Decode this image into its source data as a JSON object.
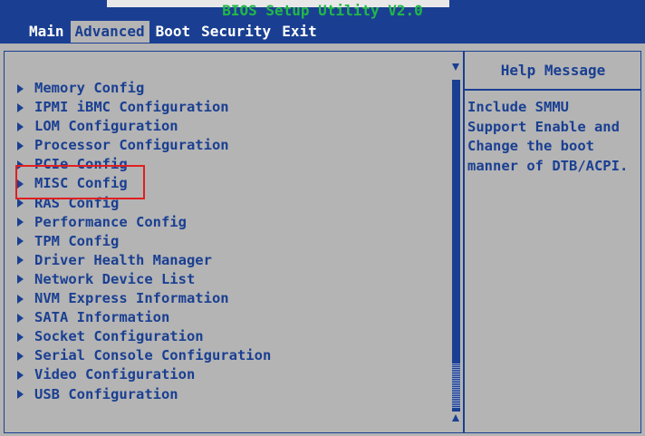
{
  "title": "BIOS Setup Utility V2.0",
  "menu": [
    {
      "label": "Main",
      "active": false
    },
    {
      "label": "Advanced",
      "active": true
    },
    {
      "label": "Boot",
      "active": false
    },
    {
      "label": "Security",
      "active": false
    },
    {
      "label": "Exit",
      "active": false
    }
  ],
  "items": [
    "Memory Config",
    "IPMI iBMC Configuration",
    "LOM Configuration",
    "Processor Configuration",
    "PCIe Config",
    "MISC Config",
    "RAS Config",
    "Performance Config",
    "TPM Config",
    "Driver Health Manager",
    "Network Device List",
    "NVM Express Information",
    "SATA Information",
    "Socket Configuration",
    "Serial Console Configuration",
    "Video Configuration",
    "USB Configuration"
  ],
  "selected_index": 5,
  "help": {
    "title": "Help Message",
    "lines": [
      "Include SMMU",
      "Support Enable and",
      "Change the boot",
      "manner of DTB/ACPI."
    ]
  },
  "colors": {
    "background": "#b4b4b4",
    "bios_blue": "#1a3f92",
    "title_green": "#22b848",
    "highlight_red": "#e02020"
  }
}
